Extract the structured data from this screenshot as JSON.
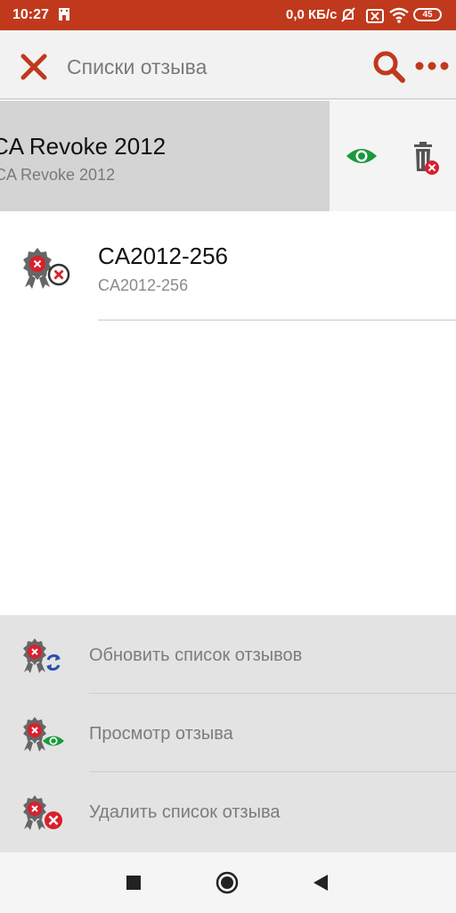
{
  "status_bar": {
    "time": "10:27",
    "network_speed": "0,0 КБ/с",
    "battery": "45",
    "icons": [
      "tower-icon",
      "mute-icon",
      "sim-icon",
      "wifi-icon",
      "battery-icon"
    ],
    "color": "#c0391d"
  },
  "app_bar": {
    "title": "Списки отзыва",
    "close_icon": "close-icon",
    "search_icon": "search-icon",
    "more_icon": "more-icon",
    "accent": "#c0391d"
  },
  "list": {
    "items": [
      {
        "title": "CA Revoke 2012",
        "subtitle": "CA Revoke 2012",
        "swiped": true,
        "actions": [
          "view-eye-icon",
          "delete-trash-icon"
        ]
      },
      {
        "title": "CA2012-256",
        "subtitle": "CA2012-256",
        "icon": "certificate-revoked-icon"
      }
    ]
  },
  "action_sheet": {
    "items": [
      {
        "label": "Обновить список отзывов",
        "icon": "certificate-refresh-icon"
      },
      {
        "label": "Просмотр отзыва",
        "icon": "certificate-view-icon"
      },
      {
        "label": "Удалить список отзыва",
        "icon": "certificate-delete-icon"
      }
    ]
  },
  "nav_bar": {
    "buttons": [
      "recents-square-icon",
      "home-circle-icon",
      "back-triangle-icon"
    ]
  }
}
